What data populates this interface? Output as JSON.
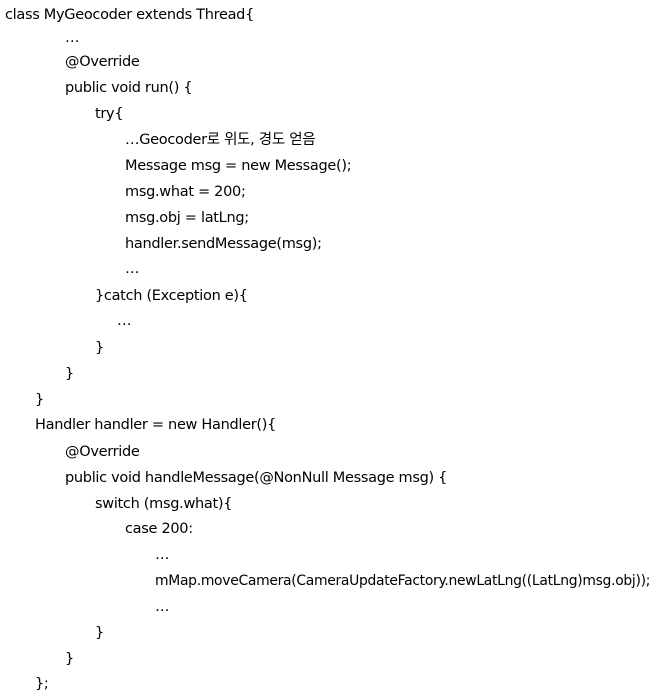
{
  "code": {
    "lines": [
      "class MyGeocoder extends Thread{",
      "…",
      "@Override",
      "public void run() {",
      "try{",
      "…Geocoder로 위도, 경도 얻음",
      "Message msg = new Message();",
      "msg.what = 200;",
      "msg.obj = latLng;",
      "handler.sendMessage(msg);",
      "…",
      "}catch (Exception e){",
      "…",
      "}",
      "}",
      "}",
      "Handler handler = new Handler(){",
      "@Override",
      "public void handleMessage(@NonNull Message msg) {",
      "switch (msg.what){",
      "case 200:",
      "…",
      "mMap.moveCamera(CameraUpdateFactory.newLatLng((LatLng)msg.obj));",
      "…",
      "}",
      "}",
      "};"
    ]
  }
}
